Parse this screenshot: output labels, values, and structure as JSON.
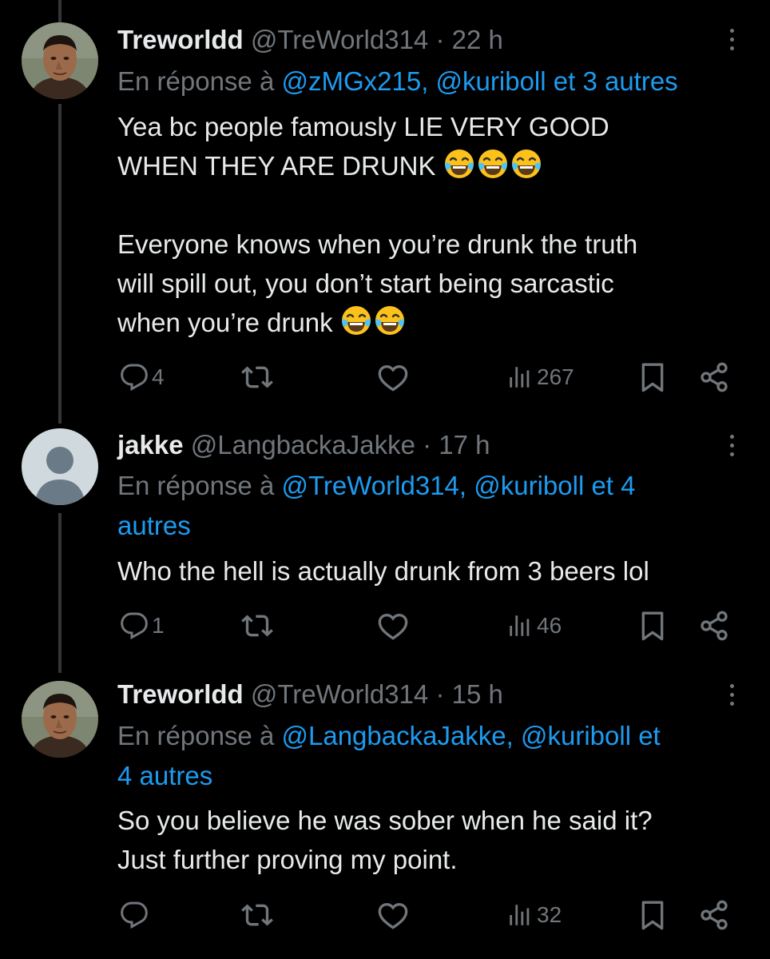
{
  "tweets": [
    {
      "name": "Treworldd",
      "handle": "@TreWorld314",
      "dot": "·",
      "time": "22 h",
      "reply_prefix": "En réponse à",
      "reply_mentions": "@zMGx215, @kuriboll et 3 autres",
      "body_lines": [
        "Yea bc people famously LIE VERY GOOD",
        "WHEN THEY ARE DRUNK",
        "Everyone knows when you’re drunk the truth",
        "will spill out, you don’t start being sarcastic",
        "when you’re drunk"
      ],
      "replies": "4",
      "views": "267",
      "avatar": "profile-photo"
    },
    {
      "name": "jakke",
      "handle": "@LangbackaJakke",
      "dot": "·",
      "time": "17 h",
      "reply_prefix": "En réponse à",
      "reply_mentions_line1": "@TreWorld314, @kuriboll et 4",
      "reply_mentions_line2": "autres",
      "body_lines": [
        "Who the hell is actually drunk from 3 beers lol"
      ],
      "replies": "1",
      "views": "46",
      "avatar": "default-profile"
    },
    {
      "name": "Treworldd",
      "handle": "@TreWorld314",
      "dot": "·",
      "time": "15 h",
      "reply_prefix": "En réponse à",
      "reply_mentions_line1": "@LangbackaJakke, @kuriboll et",
      "reply_mentions_line2": "4 autres",
      "body_lines": [
        "So you believe he was sober when he said it?",
        "Just further proving my point."
      ],
      "replies": "",
      "views": "32",
      "avatar": "profile-photo"
    }
  ],
  "colors": {
    "background": "#000000",
    "text": "#e7e9ea",
    "secondary": "#71767b",
    "link": "#1d9bf0",
    "thread_line": "#333639"
  },
  "icons": [
    "reply-icon",
    "retweet-icon",
    "like-icon",
    "views-icon",
    "bookmark-icon",
    "share-icon",
    "more-icon",
    "laughing-emoji"
  ]
}
